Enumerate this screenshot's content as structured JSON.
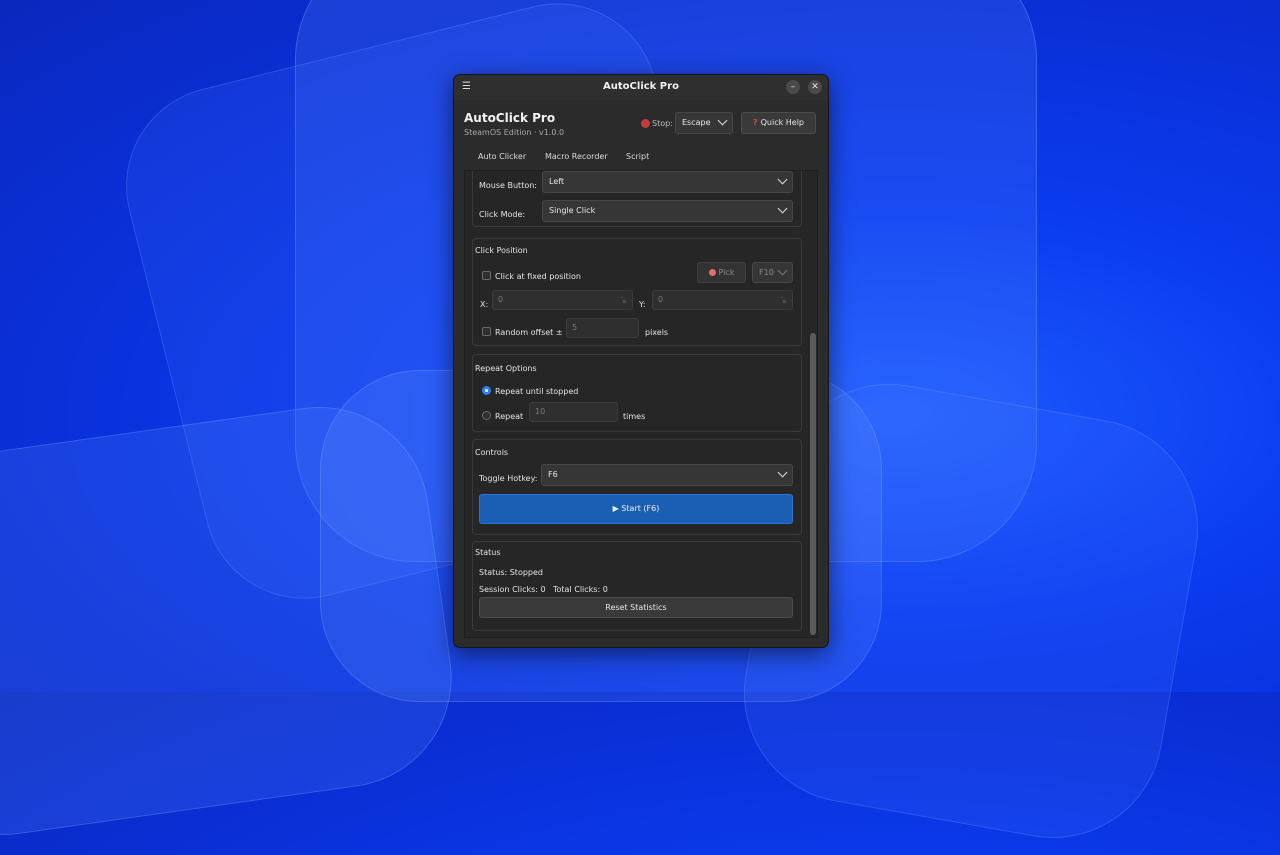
{
  "window": {
    "title": "AutoClick Pro"
  },
  "header": {
    "app_title": "AutoClick Pro",
    "subtitle": "SteamOS Edition · v1.0.0",
    "stop_label": "Stop:",
    "stop_key": "Escape",
    "help_label": "Quick Help"
  },
  "tabs": [
    {
      "label": "Auto Clicker"
    },
    {
      "label": "Macro Recorder"
    },
    {
      "label": "Script"
    }
  ],
  "click_settings": {
    "mouse_button_label": "Mouse Button:",
    "mouse_button_value": "Left",
    "click_mode_label": "Click Mode:",
    "click_mode_value": "Single Click"
  },
  "click_position": {
    "title": "Click Position",
    "fixed_label": "Click at fixed position",
    "pick_label": "Pick",
    "pick_hotkey": "F10",
    "x_label": "X:",
    "x_value": "0",
    "y_label": "Y:",
    "y_value": "0",
    "offset_label": "Random offset ±",
    "offset_value": "5",
    "offset_unit": "pixels"
  },
  "repeat": {
    "title": "Repeat Options",
    "until_stopped_label": "Repeat until stopped",
    "repeat_label": "Repeat",
    "repeat_count": "10",
    "times_label": "times"
  },
  "controls": {
    "title": "Controls",
    "hotkey_label": "Toggle Hotkey:",
    "hotkey_value": "F6",
    "start_label": "▶ Start (F6)"
  },
  "status": {
    "title": "Status",
    "status_text": "Status: Stopped",
    "session_clicks": "Session Clicks: 0",
    "total_clicks": "Total Clicks: 0",
    "reset_label": "Reset Statistics"
  },
  "colors": {
    "accent": "#1a5fb4",
    "tab_indicator": "#3d8ef0",
    "stop_dot": "#c23c3c"
  }
}
